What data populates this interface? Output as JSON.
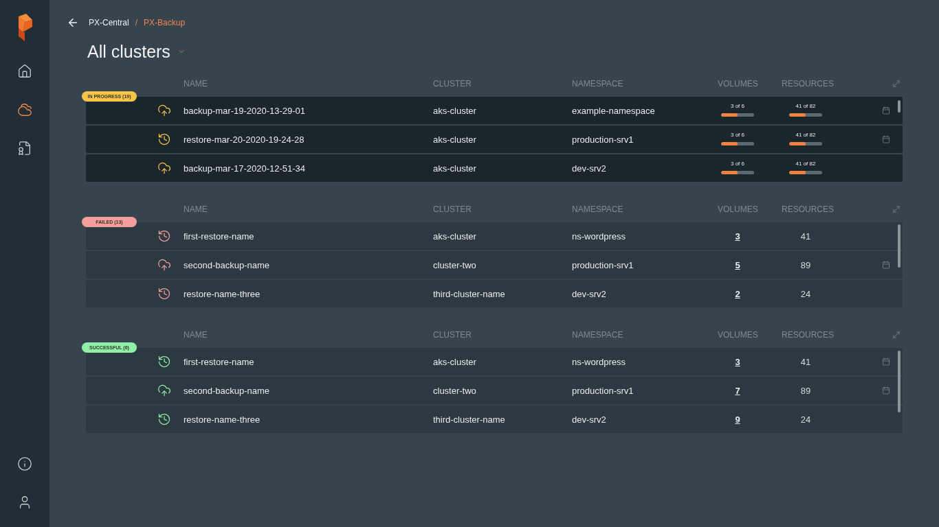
{
  "sidebar": {
    "items": [
      {
        "selected": false
      },
      {
        "selected": true
      },
      {
        "selected": false
      }
    ]
  },
  "breadcrumb": {
    "items": [
      {
        "label": "PX-Central",
        "current": false
      },
      {
        "label": "PX-Backup",
        "current": true
      }
    ],
    "separator": "/"
  },
  "title": "All clusters",
  "sections": [
    {
      "kind": "progress",
      "status": "IN PROGRESS (19)",
      "color": "#f7c548",
      "columns": [
        "NAME",
        "CLUSTER",
        "NAMESPACE",
        "VOLUMES",
        "RESOURCES"
      ],
      "rows": [
        {
          "kind": "backup",
          "name": "backup-mar-19-2020-13-29-01",
          "cluster": "aks-cluster",
          "namespace": "example-namespace",
          "volumes": {
            "text": "3 of 6",
            "level": 0.5
          },
          "resources": {
            "text": "41 of 82",
            "level": 0.5
          },
          "scheduled": true
        },
        {
          "kind": "restore",
          "name": "restore-mar-20-2020-19-24-28",
          "cluster": "aks-cluster",
          "namespace": "production-srv1",
          "volumes": {
            "text": "3 of 6",
            "level": 0.5
          },
          "resources": {
            "text": "41 of 82",
            "level": 0.5
          },
          "scheduled": true
        },
        {
          "kind": "backup",
          "name": "backup-mar-17-2020-12-51-34",
          "cluster": "aks-cluster",
          "namespace": "dev-srv2",
          "volumes": {
            "text": "3 of 6",
            "level": 0.5
          },
          "resources": {
            "text": "41 of 82",
            "level": 0.5
          },
          "scheduled": false
        }
      ]
    },
    {
      "kind": "summary",
      "status": "FAILED (13)",
      "color": "#f59e9e",
      "columns": [
        "NAME",
        "CLUSTER",
        "NAMESPACE",
        "VOLUMES",
        "RESOURCES"
      ],
      "rows": [
        {
          "kind": "restore",
          "name": "first-restore-name",
          "cluster": "aks-cluster",
          "namespace": "ns-wordpress",
          "volumes": "3",
          "resources": "41",
          "scheduled": false
        },
        {
          "kind": "backup",
          "name": "second-backup-name",
          "cluster": "cluster-two",
          "namespace": "production-srv1",
          "volumes": "5",
          "resources": "89",
          "scheduled": true
        },
        {
          "kind": "restore",
          "name": "restore-name-three",
          "cluster": "third-cluster-name",
          "namespace": "dev-srv2",
          "volumes": "2",
          "resources": "24",
          "scheduled": false
        }
      ]
    },
    {
      "kind": "summary",
      "status": "SUCCESSFUL (6)",
      "color": "#8ef0a6",
      "columns": [
        "NAME",
        "CLUSTER",
        "NAMESPACE",
        "VOLUMES",
        "RESOURCES"
      ],
      "rows": [
        {
          "kind": "restore",
          "name": "first-restore-name",
          "cluster": "aks-cluster",
          "namespace": "ns-wordpress",
          "volumes": "3",
          "resources": "41",
          "scheduled": true
        },
        {
          "kind": "backup",
          "name": "second-backup-name",
          "cluster": "cluster-two",
          "namespace": "production-srv1",
          "volumes": "7",
          "resources": "89",
          "scheduled": true
        },
        {
          "kind": "restore",
          "name": "restore-name-three",
          "cluster": "third-cluster-name",
          "namespace": "dev-srv2",
          "volumes": "9",
          "resources": "24",
          "scheduled": false
        }
      ]
    }
  ]
}
